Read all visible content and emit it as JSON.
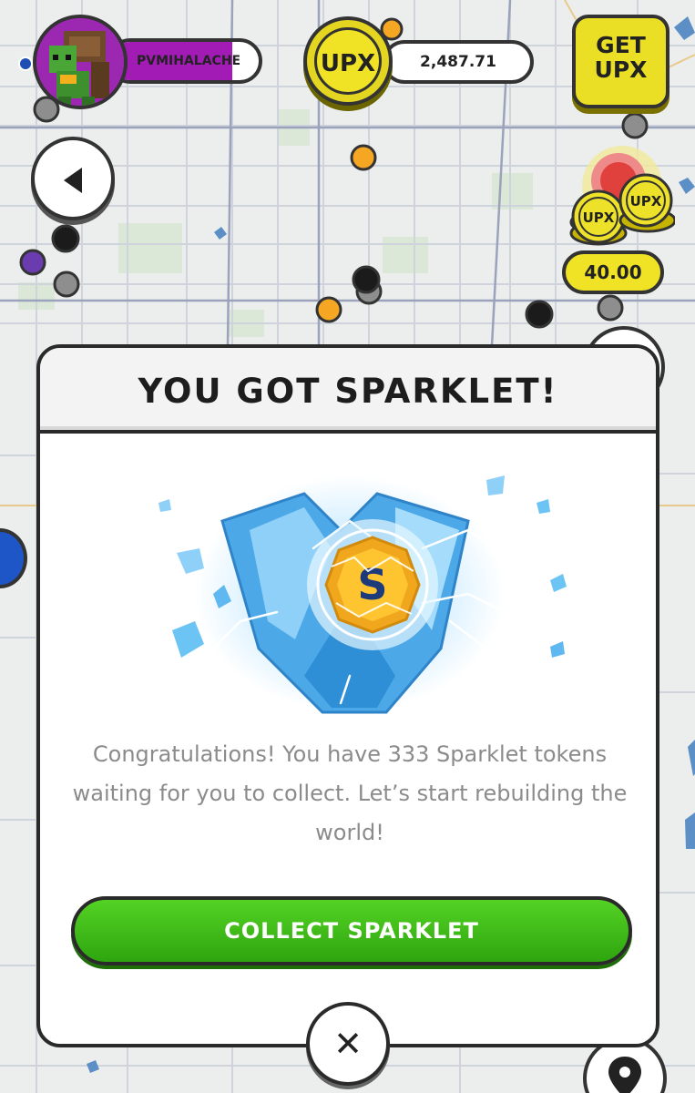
{
  "header": {
    "username": "PVMIHALACHE",
    "currency_label": "UPX",
    "balance": "2,487.71",
    "get_upx_label": "GET\nUPX"
  },
  "map": {
    "reward_amount": "40.00",
    "stack_coin_label_1": "UPX",
    "stack_coin_label_2": "UPX"
  },
  "modal": {
    "title": "YOU GOT SPARKLET!",
    "token_letter": "S",
    "message": "Congratulations! You have 333 Sparklet tokens waiting for you to collect. Let’s start rebuilding the world!",
    "collect_label": "COLLECT SPARKLET",
    "close_label": "✕"
  },
  "colors": {
    "accent_green": "#3fbb17",
    "upx_yellow": "#eadf25",
    "player_purple": "#a11bb4"
  }
}
